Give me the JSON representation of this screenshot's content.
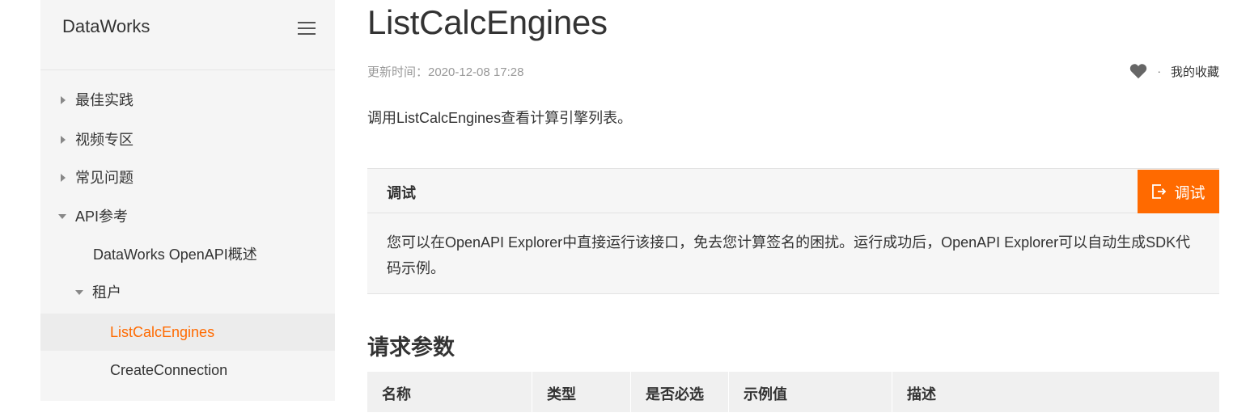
{
  "sidebar": {
    "brand": "DataWorks",
    "items": [
      {
        "label": "最佳实践"
      },
      {
        "label": "视频专区"
      },
      {
        "label": "常见问题"
      },
      {
        "label": "API参考"
      },
      {
        "label": "DataWorks OpenAPI概述"
      },
      {
        "label": "租户"
      },
      {
        "label": "ListCalcEngines"
      },
      {
        "label": "CreateConnection"
      }
    ]
  },
  "main": {
    "title": "ListCalcEngines",
    "updated": "更新时间：2020-12-08 17:28",
    "favorite": {
      "dot": "·",
      "label": "我的收藏"
    },
    "description": "调用ListCalcEngines查看计算引擎列表。",
    "debug": {
      "title": "调试",
      "button_label": "调试",
      "body": "您可以在OpenAPI Explorer中直接运行该接口，免去您计算签名的困扰。运行成功后，OpenAPI Explorer可以自动生成SDK代码示例。"
    },
    "params_title": "请求参数",
    "table_headers": [
      "名称",
      "类型",
      "是否必选",
      "示例值",
      "描述"
    ]
  },
  "colors": {
    "accent": "#ff6a00",
    "sidebar_bg": "#f5f5f5"
  }
}
